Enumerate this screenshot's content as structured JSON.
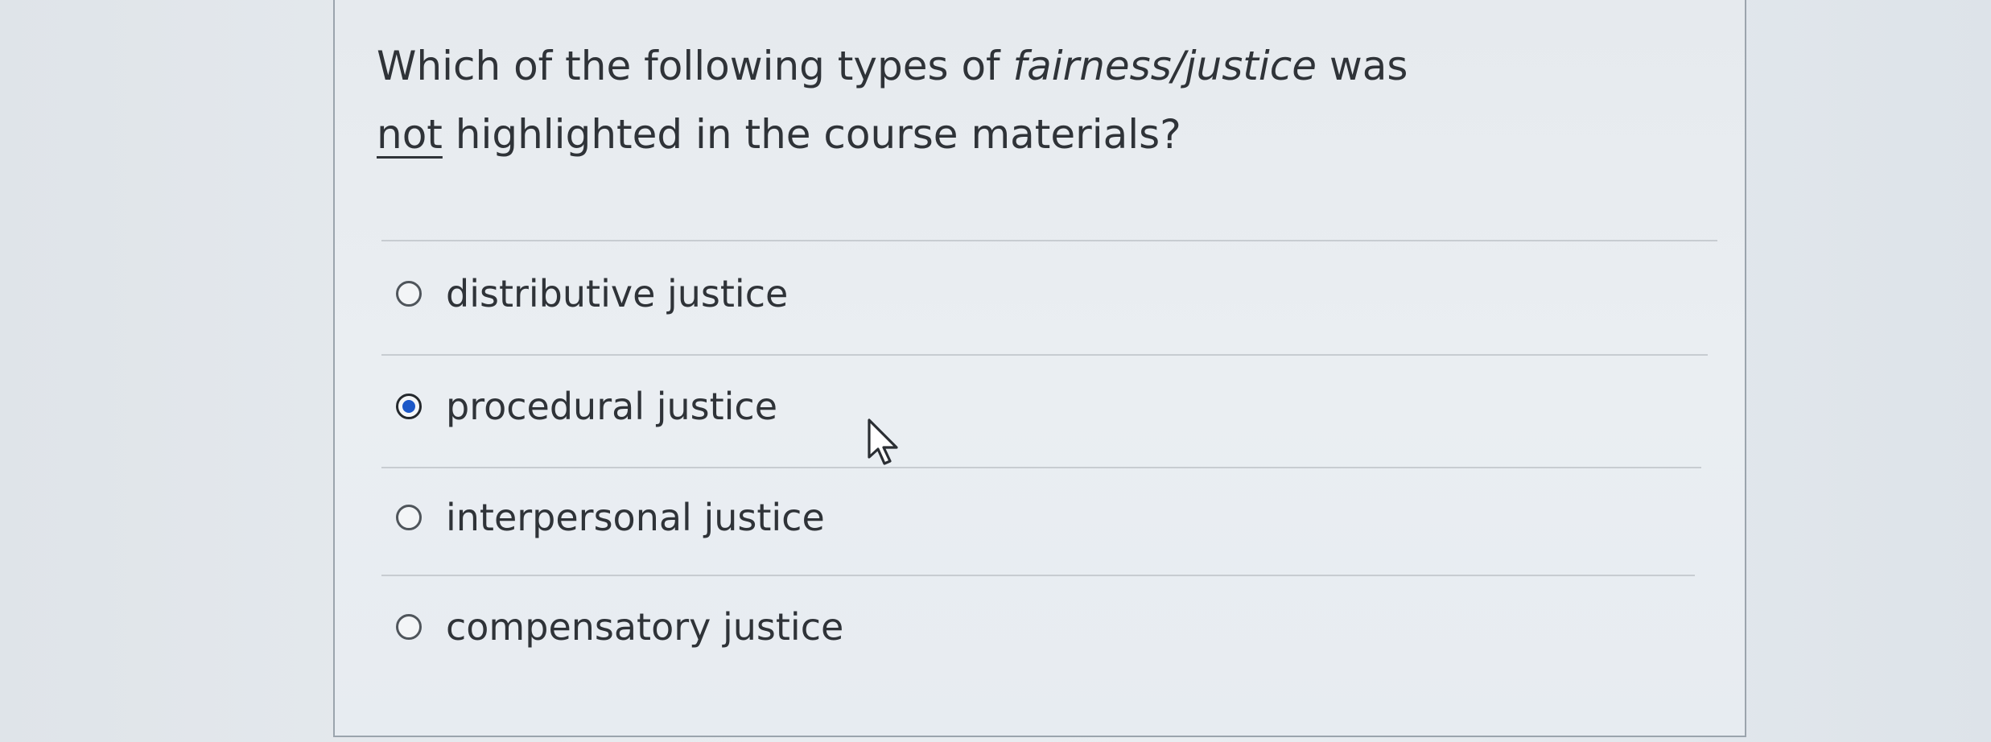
{
  "question": {
    "part1": "Which of the following types of ",
    "italic": "fairness/justice",
    "part2": " was",
    "underlined": "not",
    "part3": " highlighted in the course materials?"
  },
  "options": [
    {
      "label": "distributive justice",
      "selected": false
    },
    {
      "label": "procedural justice",
      "selected": true
    },
    {
      "label": "interpersonal justice",
      "selected": false
    },
    {
      "label": "compensatory justice",
      "selected": false
    }
  ],
  "cursor_icon": "pointer-arrow-icon",
  "colors": {
    "selected_radio": "#1c58c8",
    "text": "#2f3338",
    "divider": "#c7ccd1"
  }
}
